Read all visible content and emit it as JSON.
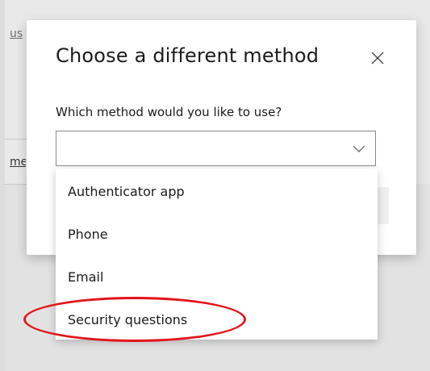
{
  "background": {
    "fragment_1": "us",
    "fragment_2": "me"
  },
  "dialog": {
    "title": "Choose a different method",
    "close_icon": "close-icon",
    "question_label": "Which method would you like to use?",
    "select_value": "",
    "select_icon": "chevron-down-icon"
  },
  "dropdown": {
    "options": [
      {
        "label": "Authenticator app"
      },
      {
        "label": "Phone"
      },
      {
        "label": "Email"
      },
      {
        "label": "Security questions"
      }
    ]
  },
  "annotation": {
    "highlight_color": "#e3141b"
  }
}
